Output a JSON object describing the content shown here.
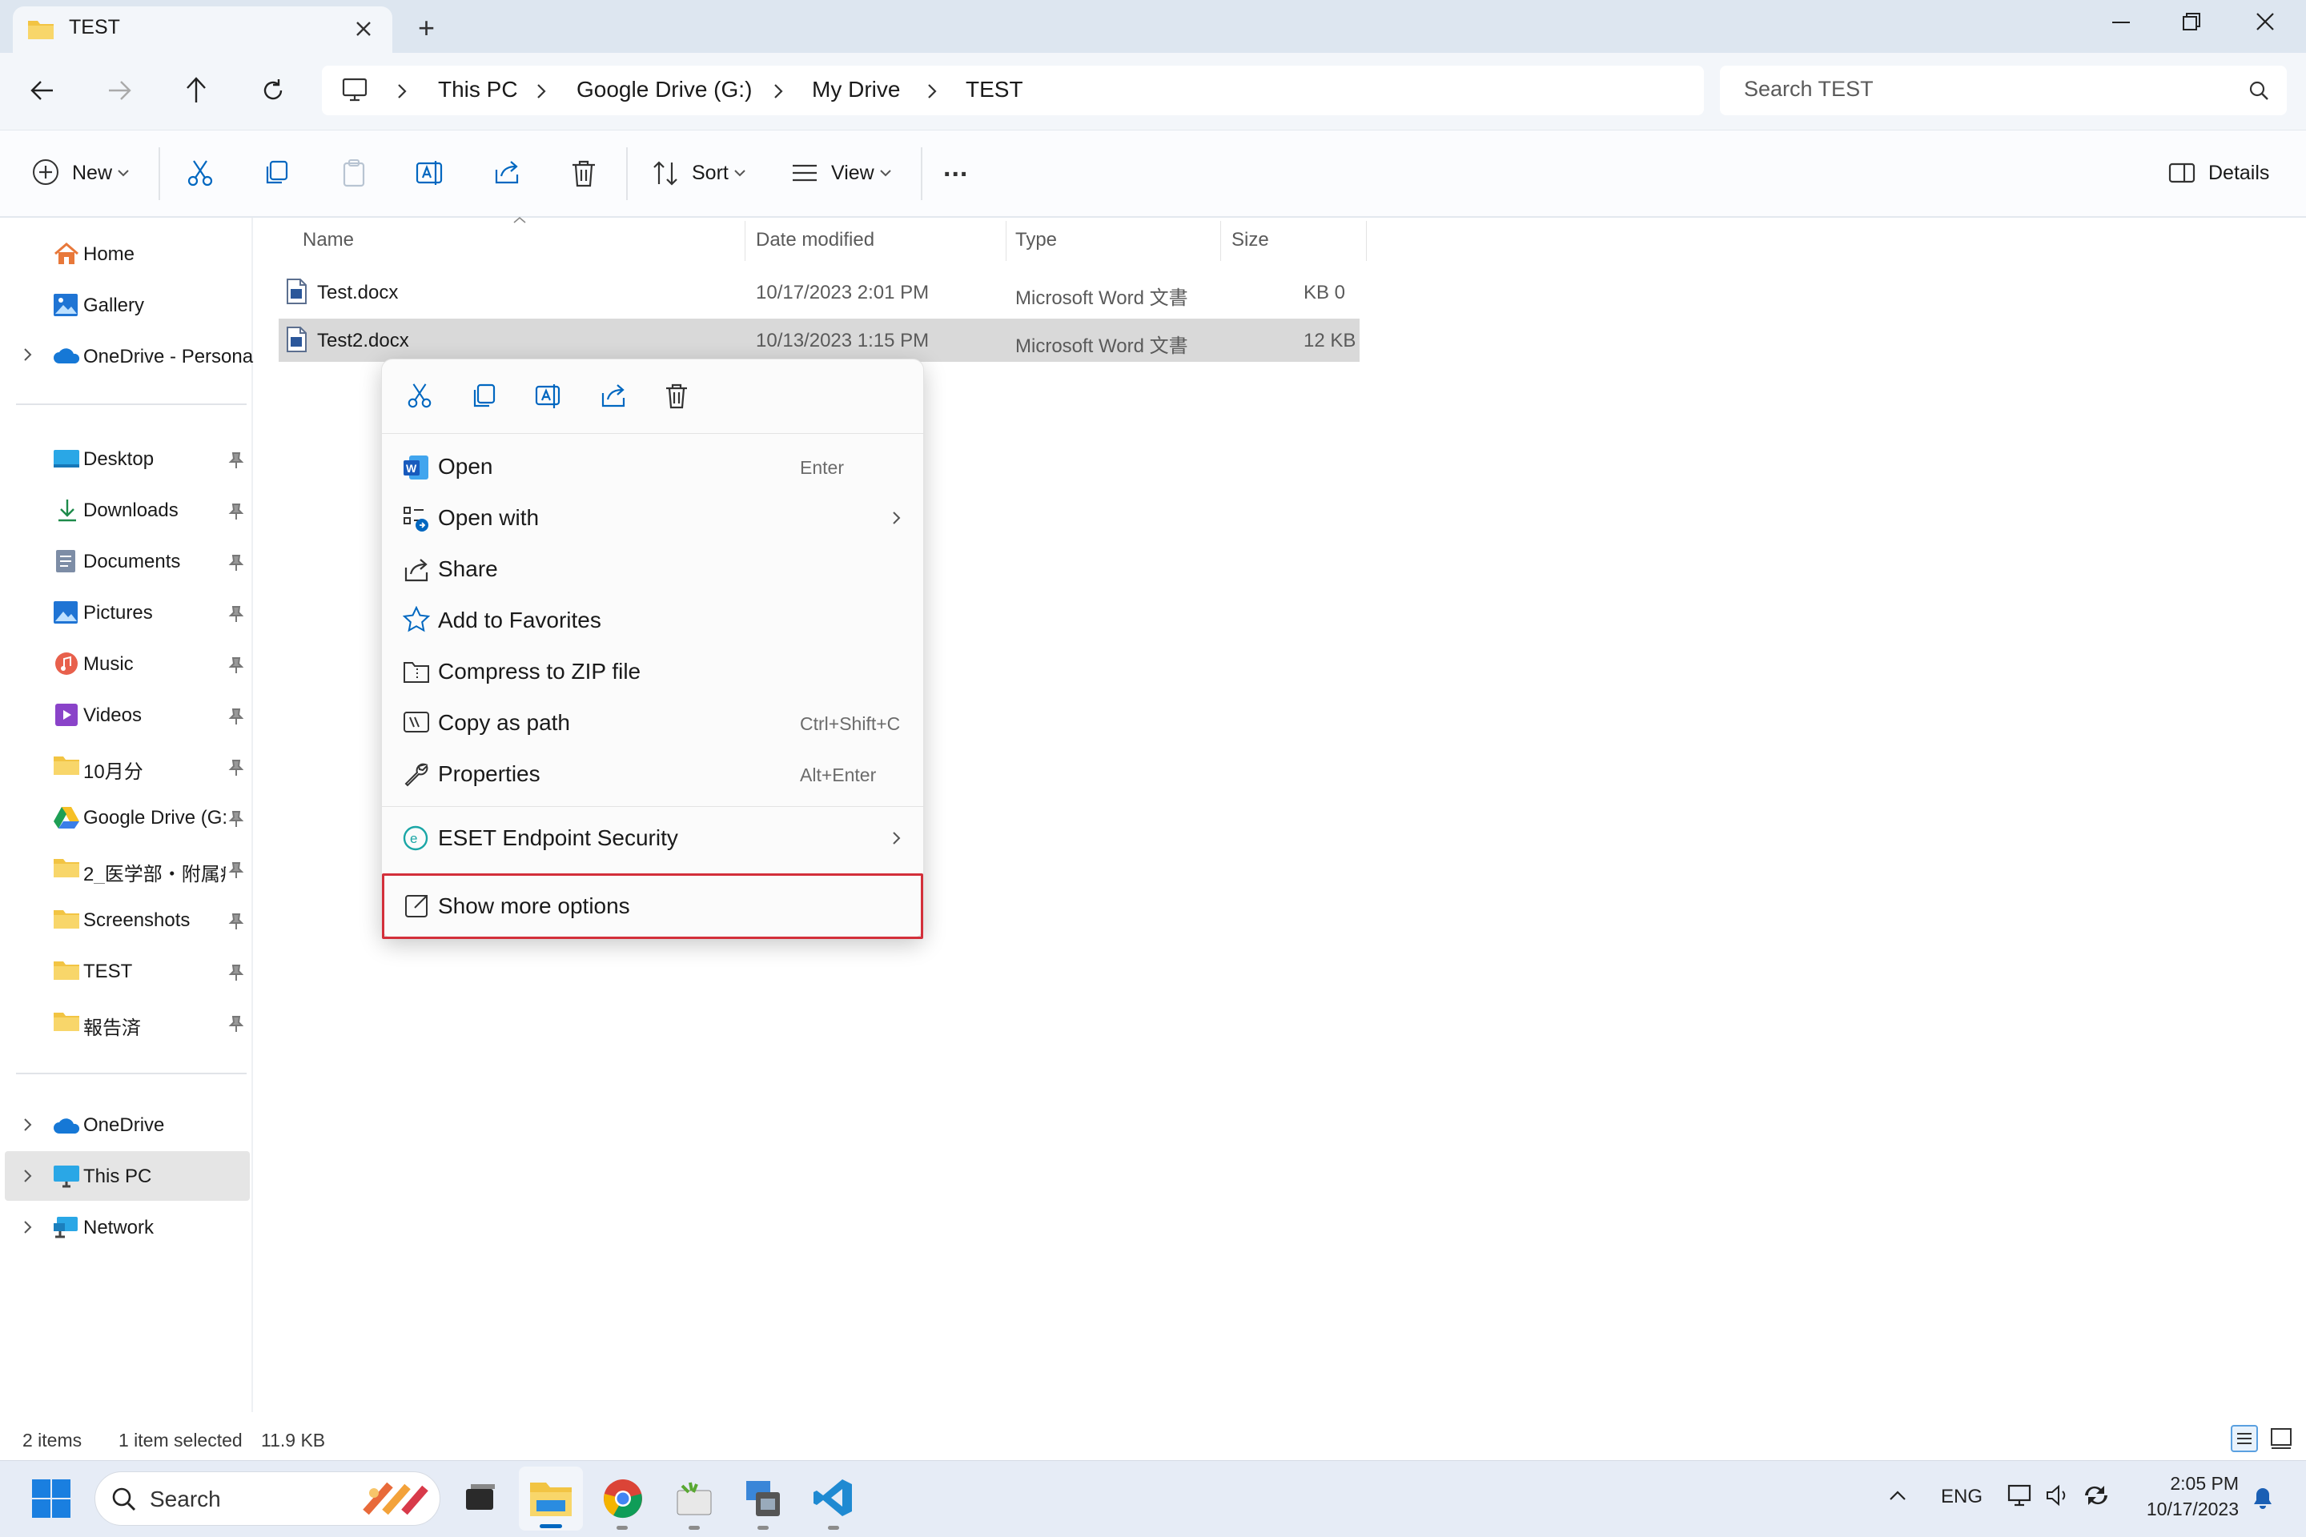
{
  "window": {
    "tab_title": "TEST",
    "tab_add_symbol": "+"
  },
  "address": {
    "crumbs": [
      "This PC",
      "Google Drive (G:)",
      "My Drive",
      "TEST"
    ],
    "search_placeholder": "Search TEST"
  },
  "toolbar": {
    "new_label": "New",
    "sort_label": "Sort",
    "view_label": "View",
    "more_label": "...",
    "details_label": "Details"
  },
  "sidebar": {
    "top": [
      {
        "label": "Home",
        "icon": "home-icon"
      },
      {
        "label": "Gallery",
        "icon": "gallery-icon"
      },
      {
        "label": "OneDrive - Persona",
        "icon": "onedrive-icon"
      }
    ],
    "quick_access": [
      {
        "label": "Desktop",
        "icon": "desktop-icon"
      },
      {
        "label": "Downloads",
        "icon": "download-icon"
      },
      {
        "label": "Documents",
        "icon": "documents-icon"
      },
      {
        "label": "Pictures",
        "icon": "pictures-icon"
      },
      {
        "label": "Music",
        "icon": "music-icon"
      },
      {
        "label": "Videos",
        "icon": "videos-icon"
      },
      {
        "label": "10月分",
        "icon": "folder-icon"
      },
      {
        "label": "Google Drive (G:",
        "icon": "google-drive-icon"
      },
      {
        "label": "2_医学部・附属病",
        "icon": "folder-icon"
      },
      {
        "label": "Screenshots",
        "icon": "folder-icon"
      },
      {
        "label": "TEST",
        "icon": "folder-icon"
      },
      {
        "label": "報告済",
        "icon": "folder-icon"
      }
    ],
    "bottom": [
      {
        "label": "OneDrive",
        "icon": "onedrive-icon"
      },
      {
        "label": "This PC",
        "icon": "this-pc-icon"
      },
      {
        "label": "Network",
        "icon": "network-icon"
      }
    ]
  },
  "files": {
    "columns": [
      "Name",
      "Date modified",
      "Type",
      "Size"
    ],
    "rows": [
      {
        "name": "Test.docx",
        "date": "10/17/2023 2:01 PM",
        "type": "Microsoft Word 文書",
        "size": "0 KB"
      },
      {
        "name": "Test2.docx",
        "date": "10/13/2023 1:15 PM",
        "type": "Microsoft Word 文書",
        "size": "12 KB"
      }
    ]
  },
  "context_menu": {
    "items": [
      {
        "label": "Open",
        "shortcut": "Enter",
        "icon": "word-icon"
      },
      {
        "label": "Open with",
        "shortcut": "",
        "icon": "open-with-icon"
      },
      {
        "label": "Share",
        "shortcut": "",
        "icon": "share-icon"
      },
      {
        "label": "Add to Favorites",
        "shortcut": "",
        "icon": "star-icon"
      },
      {
        "label": "Compress to ZIP file",
        "shortcut": "",
        "icon": "zip-icon"
      },
      {
        "label": "Copy as path",
        "shortcut": "Ctrl+Shift+C",
        "icon": "copy-path-icon"
      },
      {
        "label": "Properties",
        "shortcut": "Alt+Enter",
        "icon": "wrench-icon"
      },
      {
        "label": "ESET Endpoint Security",
        "shortcut": "",
        "icon": "eset-icon"
      },
      {
        "label": "Show more options",
        "shortcut": "",
        "icon": "show-more-icon"
      }
    ],
    "highlight_color": "#d32f3a"
  },
  "status": {
    "count": "2 items",
    "selected": "1 item selected",
    "size": "11.9 KB"
  },
  "taskbar": {
    "search_label": "Search",
    "lang": "ENG",
    "time": "2:05 PM",
    "date": "10/17/2023"
  },
  "colors": {
    "accent": "#0067c0",
    "selection": "#d9d9d9",
    "titlebar": "#dde6f0",
    "folder": "#f2c443"
  }
}
